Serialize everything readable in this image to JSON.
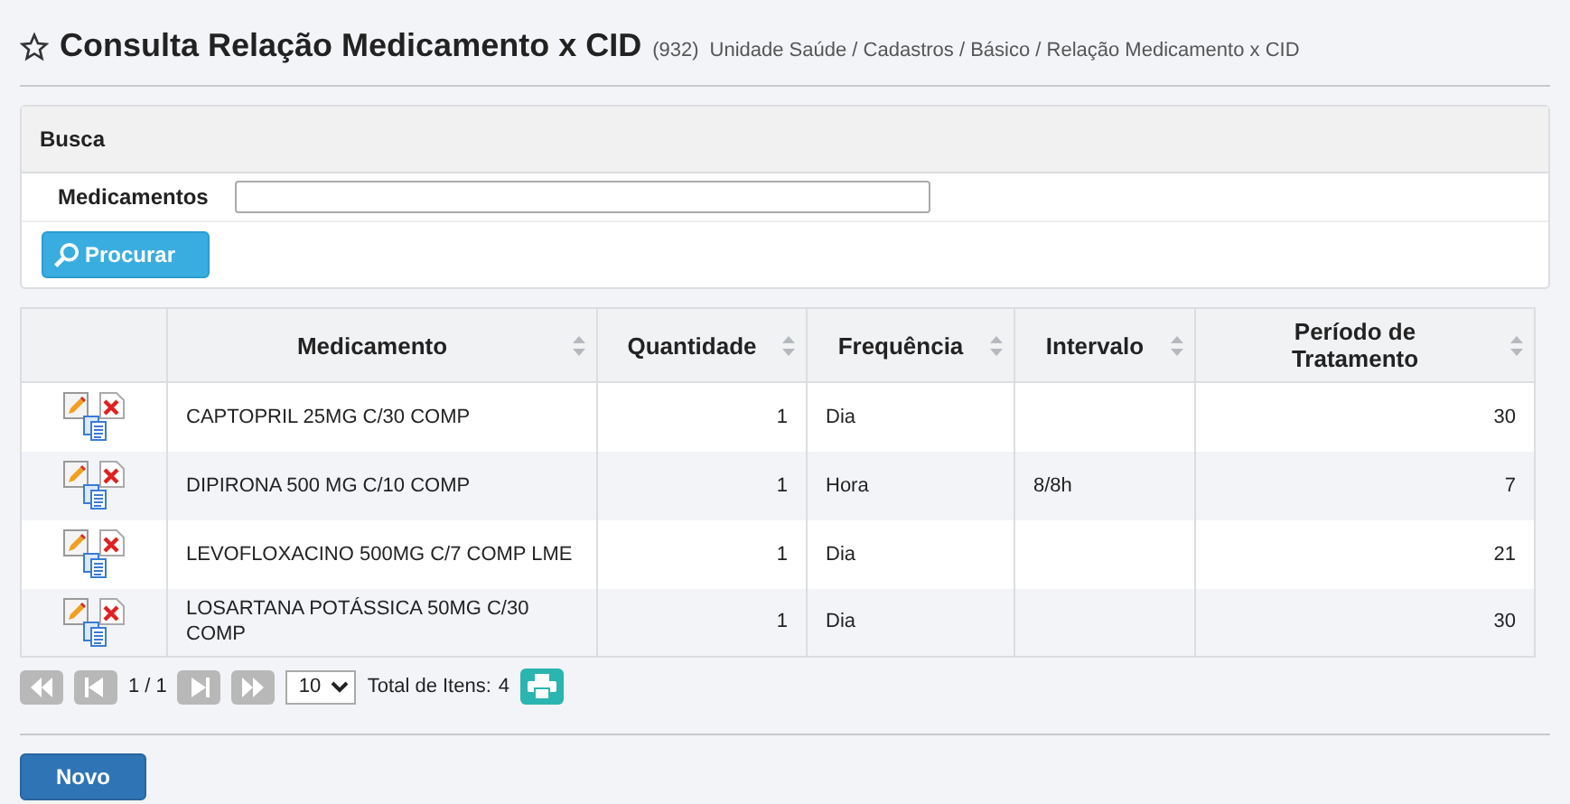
{
  "header": {
    "title": "Consulta Relação Medicamento x CID",
    "count": "(932)",
    "breadcrumb": "Unidade Saúde / Cadastros / Básico / Relação Medicamento x CID"
  },
  "search": {
    "title": "Busca",
    "field_label": "Medicamentos",
    "button": "Procurar"
  },
  "table": {
    "columns": [
      "Medicamento",
      "Quantidade",
      "Frequência",
      "Intervalo",
      "Período de Tratamento"
    ],
    "rows": [
      [
        "CAPTOPRIL 25MG C/30 COMP",
        "1",
        "Dia",
        "",
        "30"
      ],
      [
        "DIPIRONA 500 MG C/10 COMP",
        "1",
        "Hora",
        "8/8h",
        "7"
      ],
      [
        "LEVOFLOXACINO 500MG C/7 COMP LME",
        "1",
        "Dia",
        "",
        "21"
      ],
      [
        "LOSARTANA POTÁSSICA 50MG C/30 COMP",
        "1",
        "Dia",
        "",
        "30"
      ]
    ]
  },
  "pagination": {
    "pages": "1 / 1",
    "page_size": "10",
    "total_label": "Total de Itens:",
    "total": "4"
  },
  "new_button": "Novo"
}
